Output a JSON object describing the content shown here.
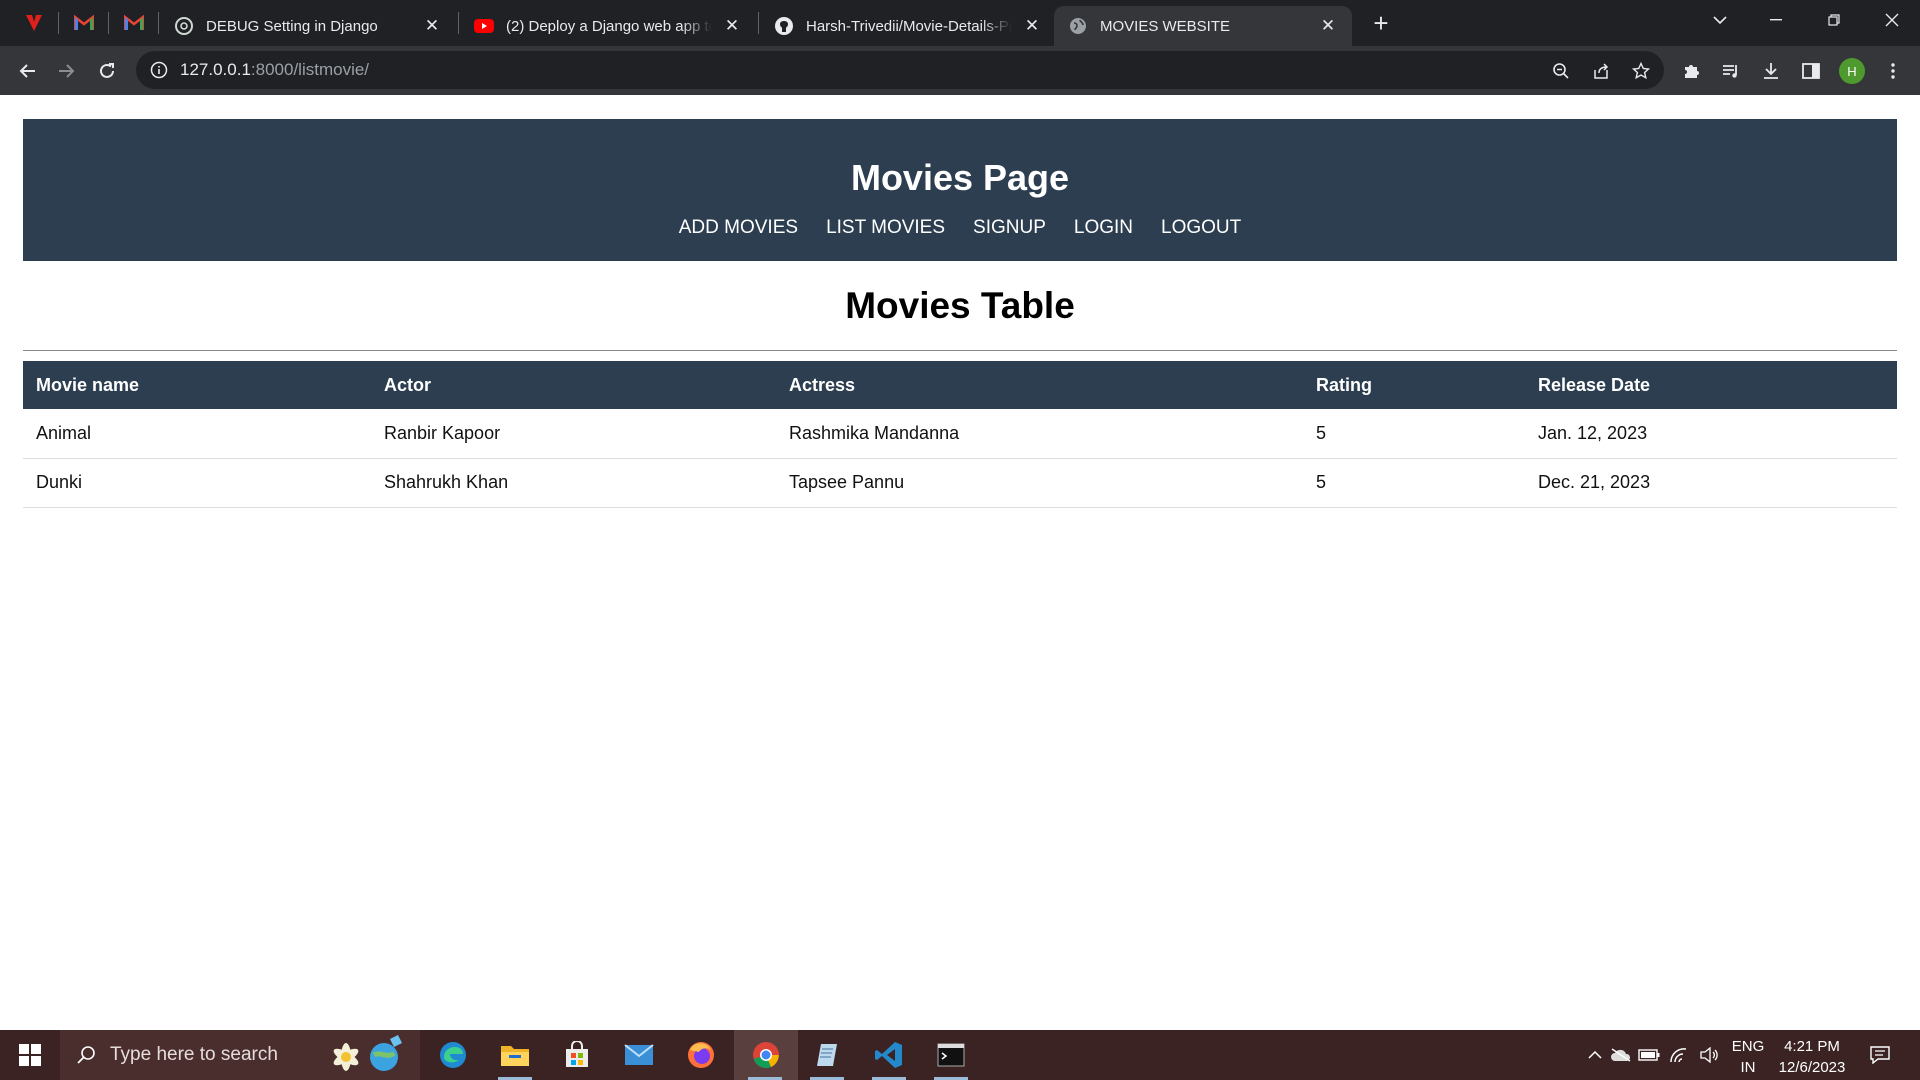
{
  "browser": {
    "tabs": [
      {
        "title": "DEBUG Setting in Django",
        "favicon": "chatgpt-icon"
      },
      {
        "title": "(2) Deploy a Django web app to",
        "favicon": "youtube-icon"
      },
      {
        "title": "Harsh-Trivedii/Movie-Details-Pro",
        "favicon": "github-icon"
      },
      {
        "title": "MOVIES WEBSITE",
        "favicon": "globe-icon",
        "active": true
      }
    ],
    "address": {
      "host": "127.0.0.1",
      "rest": ":8000/listmovie/"
    },
    "profile_initial": "H"
  },
  "page": {
    "site_title": "Movies Page",
    "nav": [
      "ADD MOVIES",
      "LIST MOVIES",
      "SIGNUP",
      "LOGIN",
      "LOGOUT"
    ],
    "table_title": "Movies Table",
    "columns": [
      "Movie name",
      "Actor",
      "Actress",
      "Rating",
      "Release Date"
    ],
    "rows": [
      [
        "Animal",
        "Ranbir Kapoor",
        "Rashmika Mandanna",
        "5",
        "Jan. 12, 2023"
      ],
      [
        "Dunki",
        "Shahrukh Khan",
        "Tapsee Pannu",
        "5",
        "Dec. 21, 2023"
      ]
    ],
    "header_color": "#2c3e50"
  },
  "taskbar": {
    "search_placeholder": "Type here to search",
    "language": "ENG",
    "region": "IN",
    "time": "4:21 PM",
    "date": "12/6/2023"
  }
}
